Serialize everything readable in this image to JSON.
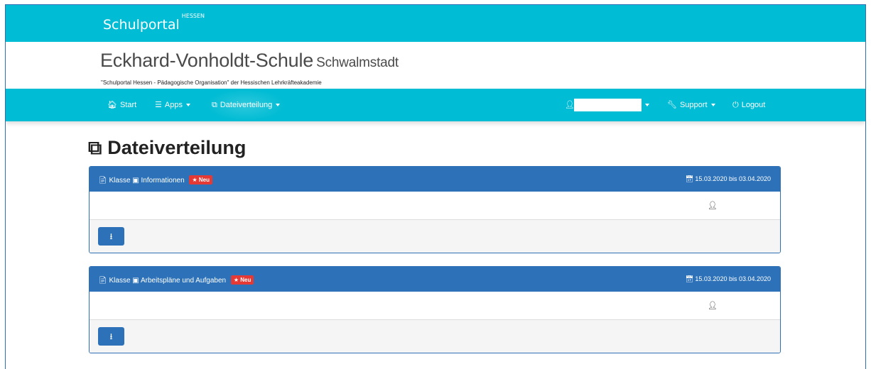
{
  "topbar": {
    "brand": "Schulportal",
    "brand_sup": "HESSEN"
  },
  "school": {
    "name": "Eckhard-Vonholdt-Schule",
    "city": "Schwalmstadt",
    "subtitle": "\"Schulportal Hessen - Pädagogische Organisation\" der Hessischen Lehrkräfteakademie"
  },
  "nav": {
    "start": "Start",
    "apps": "Apps",
    "dateiverteilung": "Dateiverteilung",
    "support": "Support",
    "logout": "Logout"
  },
  "page": {
    "title": "Dateiverteilung"
  },
  "panels": [
    {
      "class_label": "Klasse",
      "title": "Informationen",
      "badge": "Neu",
      "date": "15.03.2020 bis 03.04.2020"
    },
    {
      "class_label": "Klasse",
      "title": "Arbeitspläne und Aufgaben",
      "badge": "Neu",
      "date": "15.03.2020 bis 03.04.2020"
    }
  ],
  "icons": {
    "home": "home-icon",
    "apps": "menu-icon",
    "files": "copy-icon",
    "user": "user-icon",
    "support": "wrench-icon",
    "logout": "power-icon",
    "file": "file-icon",
    "calendar": "calendar-icon",
    "download": "download-icon",
    "star": "star-icon"
  },
  "colors": {
    "teal": "#00bcd4",
    "panel_blue": "#2d72b8",
    "badge_red": "#e53935"
  }
}
